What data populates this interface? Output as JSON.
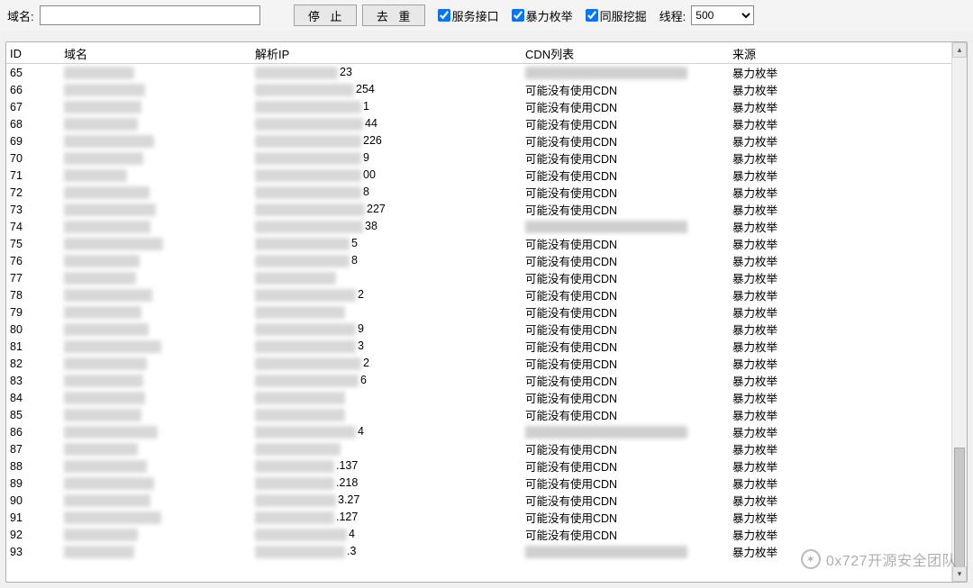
{
  "toolbar": {
    "domain_label": "域名:",
    "domain_value": "",
    "stop_label": "停 止",
    "dedup_label": "去 重",
    "cb_service": "服务接口",
    "cb_brute": "暴力枚举",
    "cb_sameserver": "同服挖掘",
    "threads_label": "线程:",
    "threads_value": "500"
  },
  "headers": {
    "id": "ID",
    "domain": "域名",
    "ip": "解析IP",
    "cdn": "CDN列表",
    "src": "来源"
  },
  "strings": {
    "cdn_none": "可能没有使用CDN",
    "src_brute": "暴力枚举"
  },
  "rows": [
    {
      "id": "65",
      "domain_blur_w": 78,
      "ip_blur_w": 92,
      "ip_suffix": "23",
      "cdn_blur": true,
      "src": "暴力枚举"
    },
    {
      "id": "66",
      "domain_blur_w": 90,
      "ip_blur_w": 110,
      "ip_suffix": "254",
      "cdn_none": true,
      "src": "暴力枚举"
    },
    {
      "id": "67",
      "domain_blur_w": 86,
      "ip_blur_w": 118,
      "ip_suffix": "1",
      "cdn_none": true,
      "src": "暴力枚举"
    },
    {
      "id": "68",
      "domain_blur_w": 82,
      "ip_blur_w": 120,
      "ip_suffix": "44",
      "cdn_none": true,
      "src": "暴力枚举"
    },
    {
      "id": "69",
      "domain_blur_w": 100,
      "ip_blur_w": 118,
      "ip_suffix": "226",
      "cdn_none": true,
      "src": "暴力枚举"
    },
    {
      "id": "70",
      "domain_blur_w": 88,
      "ip_blur_w": 118,
      "ip_suffix": "9",
      "cdn_none": true,
      "src": "暴力枚举"
    },
    {
      "id": "71",
      "domain_blur_w": 70,
      "ip_blur_w": 118,
      "ip_suffix": "00",
      "cdn_none": true,
      "src": "暴力枚举"
    },
    {
      "id": "72",
      "domain_blur_w": 95,
      "ip_blur_w": 118,
      "ip_suffix": "8",
      "cdn_none": true,
      "src": "暴力枚举"
    },
    {
      "id": "73",
      "domain_blur_w": 102,
      "ip_blur_w": 122,
      "ip_suffix": "227",
      "cdn_none": true,
      "src": "暴力枚举"
    },
    {
      "id": "74",
      "domain_blur_w": 96,
      "ip_blur_w": 120,
      "ip_suffix": "38",
      "cdn_blur": true,
      "src": "暴力枚举"
    },
    {
      "id": "75",
      "domain_blur_w": 110,
      "ip_blur_w": 105,
      "ip_suffix": "5",
      "cdn_none": true,
      "src": "暴力枚举"
    },
    {
      "id": "76",
      "domain_blur_w": 84,
      "ip_blur_w": 105,
      "ip_suffix": "8",
      "cdn_none": true,
      "src": "暴力枚举"
    },
    {
      "id": "77",
      "domain_blur_w": 80,
      "ip_blur_w": 90,
      "ip_suffix": "",
      "cdn_none": true,
      "src": "暴力枚举"
    },
    {
      "id": "78",
      "domain_blur_w": 98,
      "ip_blur_w": 112,
      "ip_suffix": "2",
      "cdn_none": true,
      "src": "暴力枚举"
    },
    {
      "id": "79",
      "domain_blur_w": 86,
      "ip_blur_w": 100,
      "ip_suffix": "",
      "cdn_none": true,
      "src": "暴力枚举"
    },
    {
      "id": "80",
      "domain_blur_w": 94,
      "ip_blur_w": 112,
      "ip_suffix": "9",
      "cdn_none": true,
      "src": "暴力枚举"
    },
    {
      "id": "81",
      "domain_blur_w": 108,
      "ip_blur_w": 112,
      "ip_suffix": "3",
      "cdn_none": true,
      "src": "暴力枚举"
    },
    {
      "id": "82",
      "domain_blur_w": 92,
      "ip_blur_w": 118,
      "ip_suffix": "2",
      "cdn_none": true,
      "src": "暴力枚举"
    },
    {
      "id": "83",
      "domain_blur_w": 88,
      "ip_blur_w": 115,
      "ip_suffix": "6",
      "cdn_none": true,
      "src": "暴力枚举"
    },
    {
      "id": "84",
      "domain_blur_w": 90,
      "ip_blur_w": 100,
      "ip_suffix": "",
      "cdn_none": true,
      "src": "暴力枚举"
    },
    {
      "id": "85",
      "domain_blur_w": 86,
      "ip_blur_w": 100,
      "ip_suffix": "",
      "cdn_none": true,
      "src": "暴力枚举"
    },
    {
      "id": "86",
      "domain_blur_w": 104,
      "ip_blur_w": 112,
      "ip_suffix": "4",
      "cdn_blur": true,
      "src": "暴力枚举"
    },
    {
      "id": "87",
      "domain_blur_w": 82,
      "ip_blur_w": 95,
      "ip_suffix": "",
      "cdn_none": true,
      "src": "暴力枚举"
    },
    {
      "id": "88",
      "domain_blur_w": 92,
      "ip_blur_w": 88,
      "ip_suffix": ".137",
      "cdn_none": true,
      "src": "暴力枚举"
    },
    {
      "id": "89",
      "domain_blur_w": 100,
      "ip_blur_w": 88,
      "ip_suffix": ".218",
      "cdn_none": true,
      "src": "暴力枚举"
    },
    {
      "id": "90",
      "domain_blur_w": 96,
      "ip_blur_w": 90,
      "ip_suffix": "3.27",
      "cdn_none": true,
      "src": "暴力枚举"
    },
    {
      "id": "91",
      "domain_blur_w": 108,
      "ip_blur_w": 88,
      "ip_suffix": ".127",
      "cdn_none": true,
      "src": "暴力枚举"
    },
    {
      "id": "92",
      "domain_blur_w": 82,
      "ip_blur_w": 102,
      "ip_suffix": "4",
      "cdn_none": true,
      "src": "暴力枚举"
    },
    {
      "id": "93",
      "domain_blur_w": 78,
      "ip_blur_w": 100,
      "ip_suffix": ".3",
      "cdn_blur": true,
      "src": "暴力枚举"
    }
  ],
  "watermark": {
    "text": "0x727开源安全团队"
  }
}
